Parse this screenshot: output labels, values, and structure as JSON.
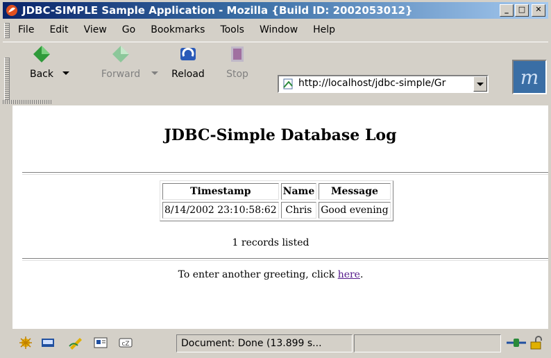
{
  "window": {
    "title": "JDBC-SIMPLE Sample Application - Mozilla {Build ID: 2002053012}",
    "minimize": "_",
    "maximize": "□",
    "close": "✕"
  },
  "menu": [
    "File",
    "Edit",
    "View",
    "Go",
    "Bookmarks",
    "Tools",
    "Window",
    "Help"
  ],
  "menu_accel": [
    "F",
    "E",
    "V",
    "G",
    "B",
    "T",
    "W",
    "H"
  ],
  "toolbar": {
    "back": "Back",
    "forward": "Forward",
    "reload": "Reload",
    "stop": "Stop",
    "url": "http://localhost/jdbc-simple/Gr"
  },
  "page": {
    "heading": "JDBC-Simple Database Log",
    "columns": [
      "Timestamp",
      "Name",
      "Message"
    ],
    "rows": [
      [
        "8/14/2002 23:10:58:62",
        "Chris",
        "Good evening"
      ]
    ],
    "count_text": "1 records listed",
    "footer_prefix": "To enter another greeting, click ",
    "footer_link": "here",
    "footer_suffix": "."
  },
  "status": {
    "text": "Document: Done (13.899 s..."
  },
  "colors": {
    "chrome": "#d4d0c8",
    "titlebar_start": "#0a246a",
    "titlebar_end": "#a6caf0",
    "link_visited": "#551a8b"
  },
  "icons": {
    "title": "mozilla-icon",
    "back": "back-arrow-icon",
    "forward": "forward-arrow-icon",
    "reload": "reload-icon",
    "stop": "stop-icon",
    "url": "page-icon",
    "throbber": "mozilla-throbber-icon",
    "status": [
      "navigator-icon",
      "mail-icon",
      "composer-icon",
      "addressbook-icon",
      "irc-chat-icon"
    ],
    "security": [
      "online-icon",
      "lock-icon"
    ]
  }
}
